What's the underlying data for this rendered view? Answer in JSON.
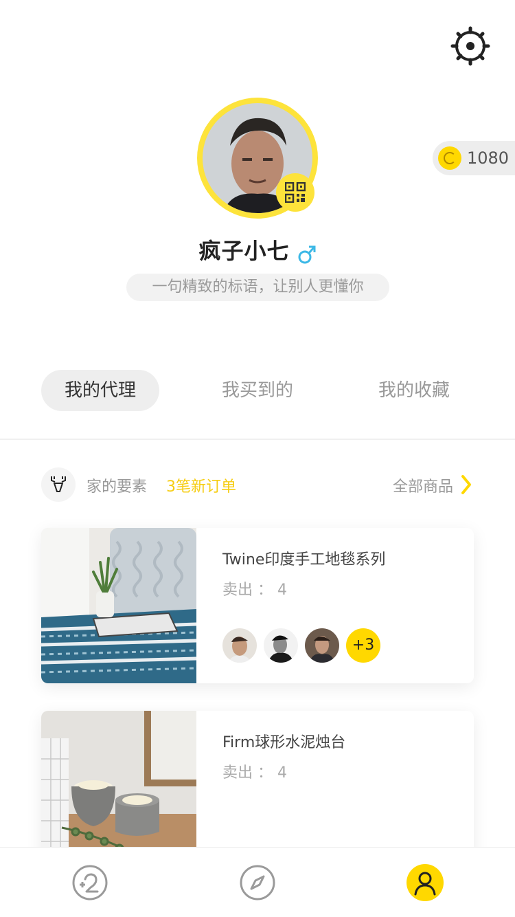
{
  "header": {
    "settings_icon": "settings-gear-icon"
  },
  "coins": {
    "count": "1080",
    "icon": "coin-icon",
    "color": "#ffd800"
  },
  "profile": {
    "username": "疯子小七",
    "gender_icon": "male-icon",
    "motto_placeholder": "一句精致的标语，让别人更懂你",
    "qr_icon": "qr-code-icon",
    "avatar_ring_color": "#fde33b"
  },
  "tabs": [
    {
      "label": "我的代理",
      "active": true
    },
    {
      "label": "我买到的",
      "active": false
    },
    {
      "label": "我的收藏",
      "active": false
    }
  ],
  "shop": {
    "logo_icon": "deer-icon",
    "name": "家的要素",
    "new_orders": "3笔新订单",
    "all_products": "全部商品"
  },
  "products": [
    {
      "title": "Twine印度手工地毯系列",
      "sold": "卖出 ： 4",
      "buyers_more": "+3"
    },
    {
      "title": "Firm球形水泥烛台",
      "sold": "卖出 ： 4"
    }
  ],
  "tabbar": [
    {
      "icon": "refresh-plus-icon",
      "active": false
    },
    {
      "icon": "compass-icon",
      "active": false
    },
    {
      "icon": "user-icon",
      "active": true
    }
  ],
  "accent_color": "#ffd800"
}
